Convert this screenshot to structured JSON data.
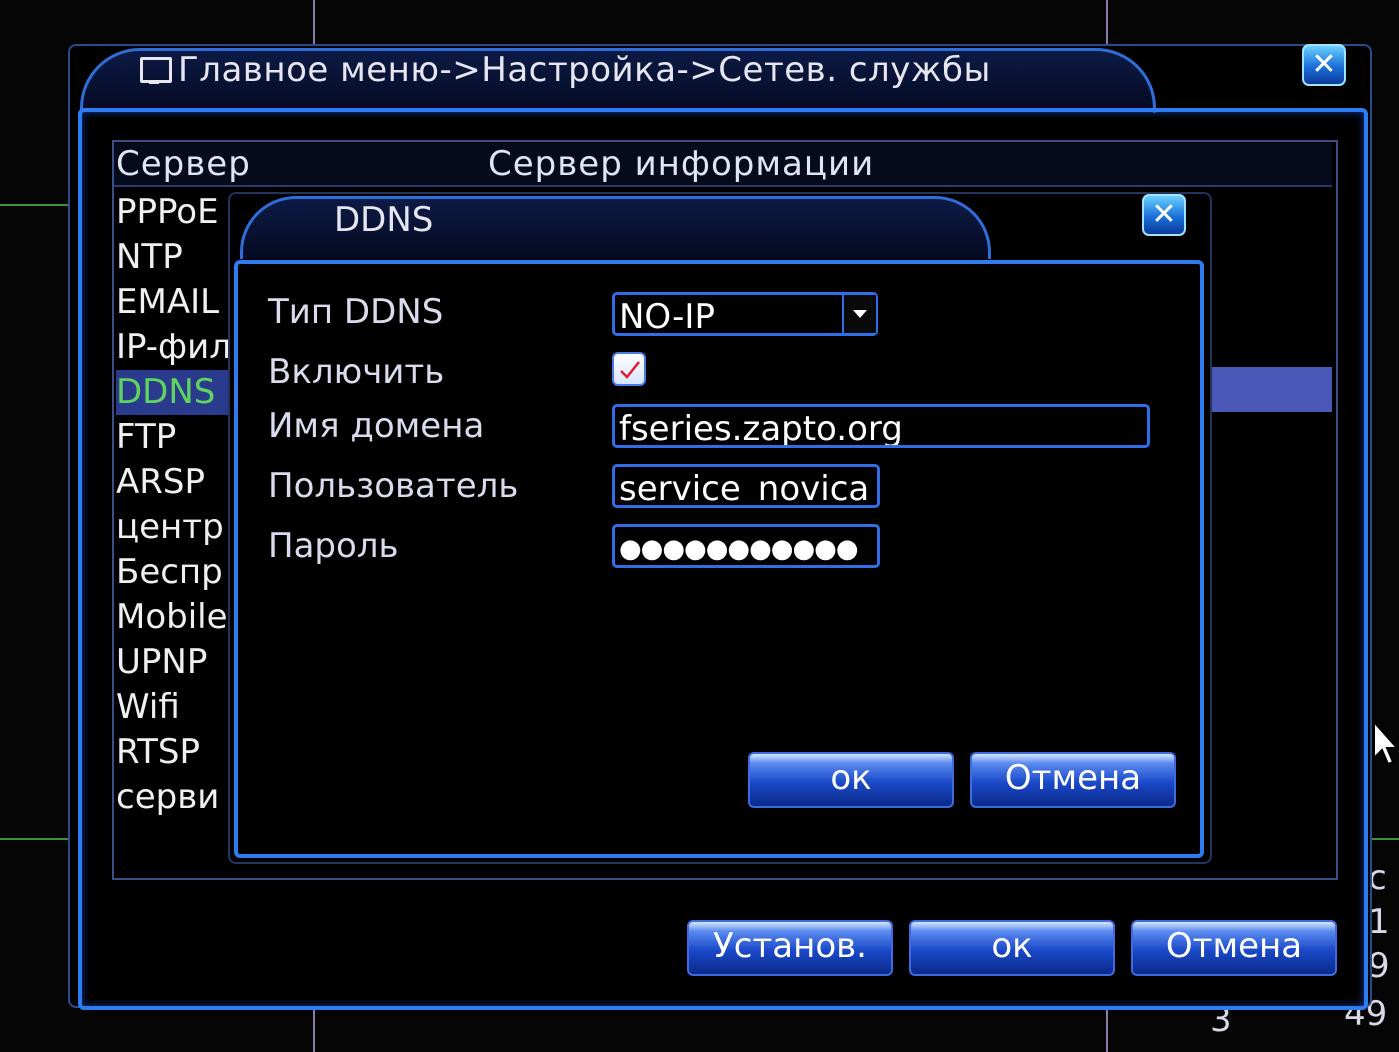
{
  "window": {
    "title": "Главное меню->Настройка->Сетев. службы",
    "close_label": "✕"
  },
  "server_list": {
    "header_server": "Сервер",
    "header_info": "Сервер информации",
    "items": [
      {
        "label": "PPPoE"
      },
      {
        "label": "NTP"
      },
      {
        "label": "EMAIL"
      },
      {
        "label": "IP-фил"
      },
      {
        "label": "DDNS",
        "active": true
      },
      {
        "label": "FTP"
      },
      {
        "label": "ARSP"
      },
      {
        "label": "центр"
      },
      {
        "label": "Беспр"
      },
      {
        "label": "Mobile"
      },
      {
        "label": "UPNP"
      },
      {
        "label": "Wifi"
      },
      {
        "label": "RTSP"
      },
      {
        "label": "серви"
      }
    ]
  },
  "main_buttons": {
    "apply": "Установ.",
    "ok": "ок",
    "cancel": "Отмена"
  },
  "ddns_dialog": {
    "title": "DDNS",
    "close_label": "✕",
    "type_label": "Тип DDNS",
    "type_value": "NO-IP",
    "enable_label": "Включить",
    "enable_checked": true,
    "domain_label": "Имя домена",
    "domain_value": "fseries.zapto.org",
    "user_label": "Пользователь",
    "user_value": "service_novica",
    "password_label": "Пароль",
    "password_value": "●●●●●●●●●●●",
    "ok": "ок",
    "cancel": "Отмена"
  },
  "background_numbers": [
    "c",
    "1",
    "9",
    "49",
    "3"
  ],
  "colors": {
    "accent_blue": "#2f7bf0",
    "active_item": "#5fd45f",
    "selection": "#4a58b8"
  }
}
